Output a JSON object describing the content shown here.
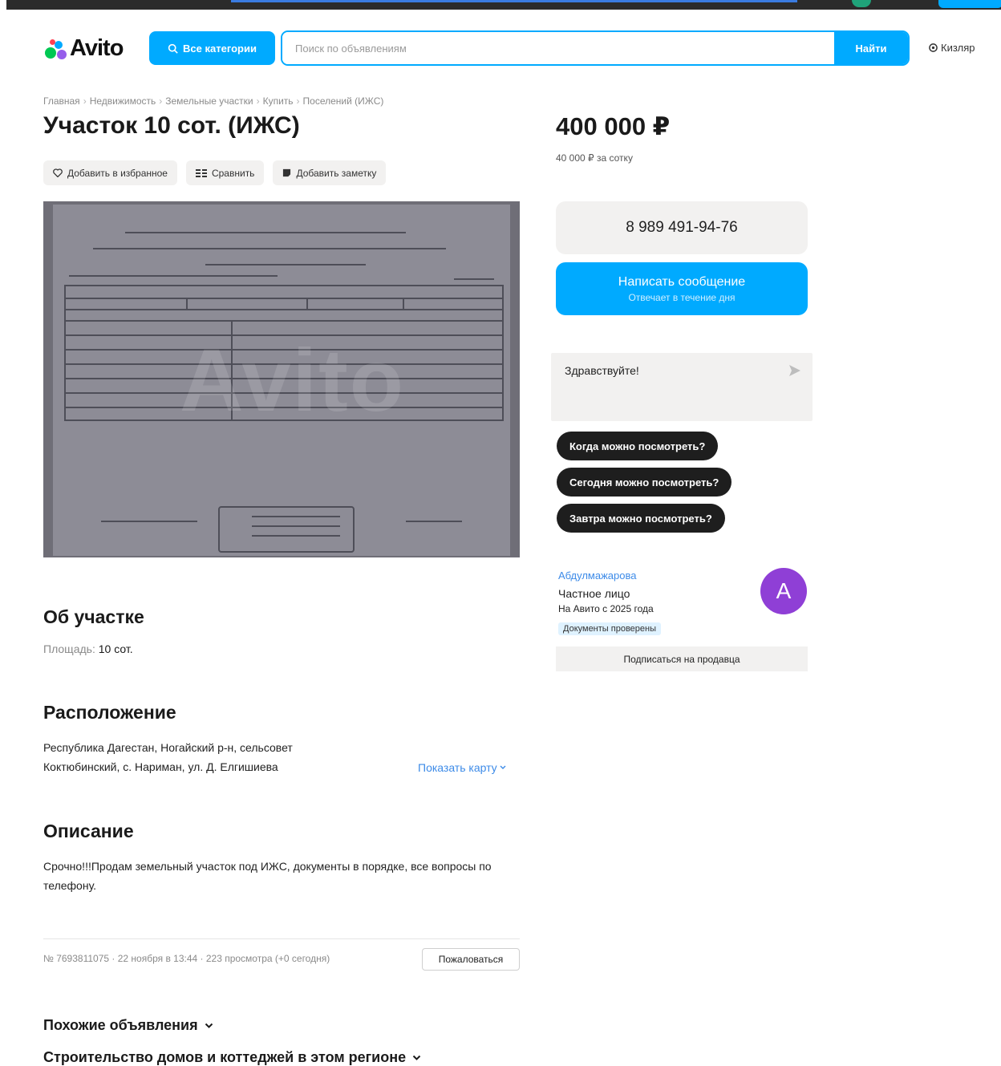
{
  "header": {
    "logo_text": "Avito",
    "categories_button": "Все категории",
    "search_placeholder": "Поиск по объявлениям",
    "search_button": "Найти",
    "location": "Кизляр",
    "brand_color": "#00aaff"
  },
  "breadcrumb": [
    "Главная",
    "Недвижимость",
    "Земельные участки",
    "Купить",
    "Поселений (ИЖС)"
  ],
  "listing": {
    "title": "Участок 10 сот. (ИЖС)",
    "actions": {
      "favorite": "Добавить в избранное",
      "compare": "Сравнить",
      "note": "Добавить заметку"
    },
    "photo_watermark": "Avito"
  },
  "sidebar": {
    "price": "400 000 ₽",
    "price_per_sotka": "40 000 ₽ за сотку",
    "phone": "8 989 491-94-76",
    "message_button": "Написать сообщение",
    "message_sub": "Отвечает в течение дня",
    "chat_placeholder": "Здравствуйте!",
    "quick_questions": [
      "Когда можно посмотреть?",
      "Сегодня можно посмотреть?",
      "Завтра можно посмотреть?"
    ],
    "seller": {
      "name": "Абдулмажарова",
      "type": "Частное лицо",
      "since": "На Авито с 2025 года",
      "badge": "Документы проверены",
      "avatar_letter": "A",
      "avatar_color": "#8f3fd6"
    },
    "subscribe_button": "Подписаться на продавца"
  },
  "about": {
    "heading": "Об участке",
    "area_label": "Площадь:",
    "area_value": "10 сот."
  },
  "location_section": {
    "heading": "Расположение",
    "address_line1": "Республика Дагестан, Ногайский р-н, сельсовет",
    "address_line2": "Коктюбинский, с. Нариман, ул. Д. Елгишиева",
    "map_link": "Показать карту"
  },
  "description_section": {
    "heading": "Описание",
    "text": "Срочно!!!Продам земельный участок под ИЖС, документы в порядке, все вопросы по телефону."
  },
  "footer_meta": {
    "info": "№ 7693811075 · 22 ноября в 13:44 · 223 просмотра (+0 сегодня)",
    "report_button": "Пожаловаться"
  },
  "expanders": [
    "Похожие объявления",
    "Строительство домов и коттеджей в этом регионе"
  ]
}
